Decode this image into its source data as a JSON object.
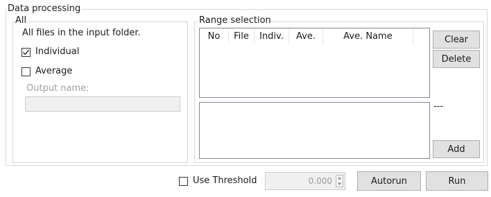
{
  "data_processing": {
    "group_label": "Data processing"
  },
  "all": {
    "group_label": "All",
    "description": "All files in the input folder.",
    "individual_label": "Individual",
    "individual_checked": true,
    "average_label": "Average",
    "average_checked": false,
    "output_name_label": "Output name:",
    "output_name_value": ""
  },
  "range_selection": {
    "group_label": "Range selection",
    "columns": [
      "No",
      "File",
      "Indiv.",
      "Ave.",
      "Ave. Name"
    ],
    "clear_label": "Clear",
    "delete_label": "Delete",
    "dash_text": "---",
    "add_label": "Add"
  },
  "bottom": {
    "use_threshold_label": "Use Threshold",
    "use_threshold_checked": false,
    "threshold_value": "0.000",
    "autorun_label": "Autorun",
    "run_label": "Run"
  }
}
